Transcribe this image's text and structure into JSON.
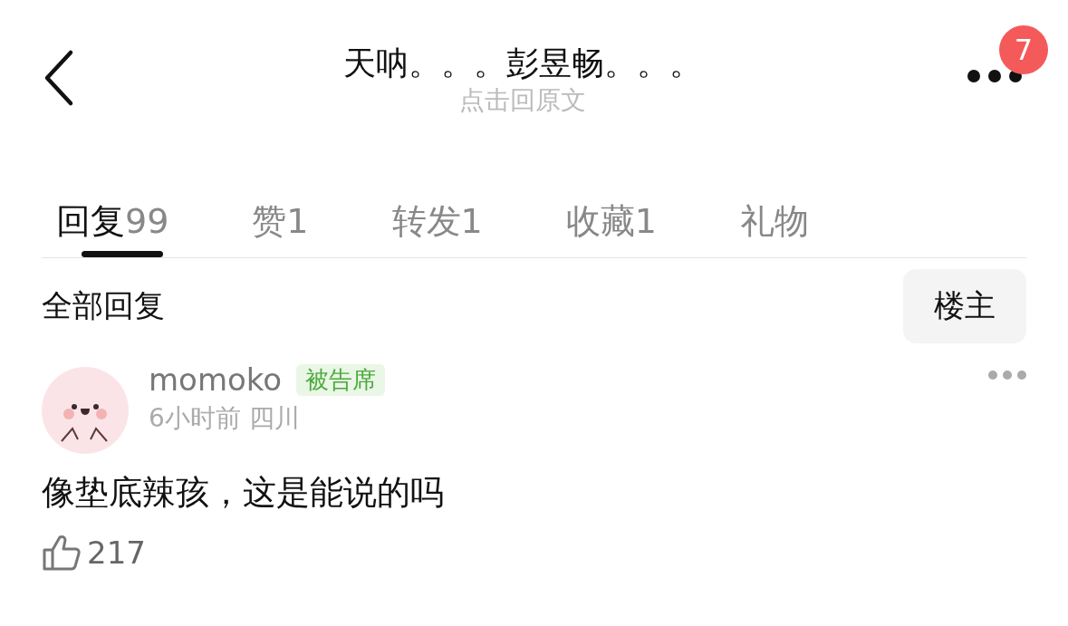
{
  "header": {
    "title": "天呐。。。彭昱畅。。。",
    "subtitle": "点击回原文",
    "badge": "7"
  },
  "tabs": [
    {
      "label": "回复",
      "count": "99",
      "selected": true
    },
    {
      "label": "赞",
      "count": "1",
      "selected": false
    },
    {
      "label": "转发",
      "count": "1",
      "selected": false
    },
    {
      "label": "收藏",
      "count": "1",
      "selected": false
    },
    {
      "label": "礼物",
      "selected": false
    }
  ],
  "section": {
    "title": "全部回复",
    "filter_button": "楼主"
  },
  "comment": {
    "user": "momoko",
    "tag": "被告席",
    "meta": "6小时前 四川",
    "text": "像垫底辣孩，这是能说的吗",
    "likes": "217"
  }
}
